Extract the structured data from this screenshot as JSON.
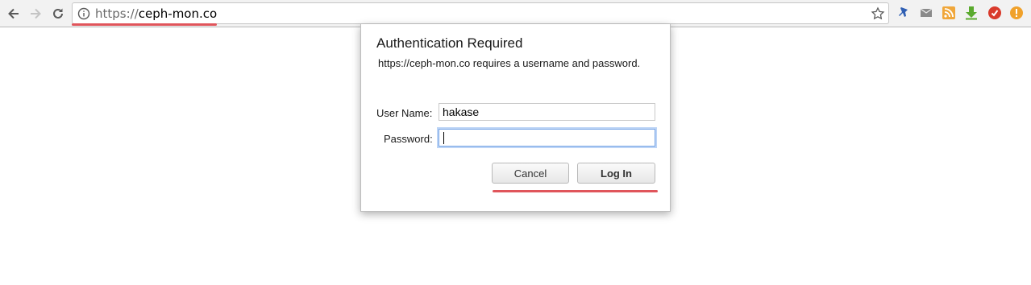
{
  "browser": {
    "url_scheme": "https://",
    "url_host": "ceph-mon.co",
    "nav": [
      "back-icon",
      "forward-icon",
      "reload-icon"
    ],
    "extensions": [
      "pin-extension-icon",
      "mail-extension-icon",
      "rss-extension-icon",
      "download-extension-icon",
      "stop-extension-icon",
      "alert-extension-icon"
    ],
    "highlight_color": "#e0555b"
  },
  "dialog": {
    "title": "Authentication Required",
    "message": "https://ceph-mon.co requires a username and password.",
    "username_label": "User Name:",
    "username_value": "hakase",
    "password_label": "Password:",
    "password_value": "",
    "cancel_label": "Cancel",
    "login_label": "Log In"
  }
}
